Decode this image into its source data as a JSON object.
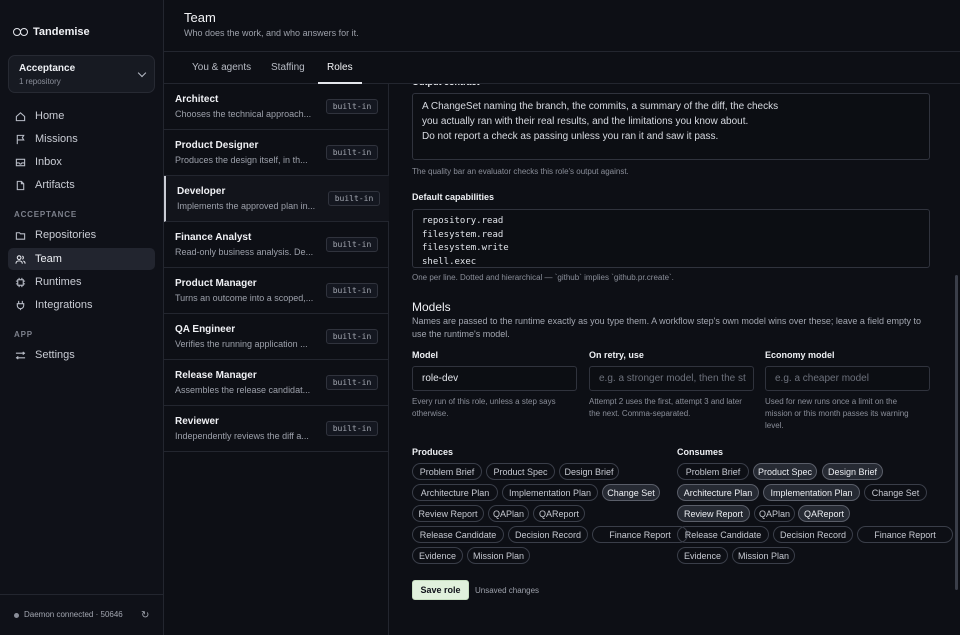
{
  "app": {
    "name": "Tandemise"
  },
  "workspace": {
    "name": "Acceptance",
    "sub": "1 repository"
  },
  "nav": {
    "main": [
      {
        "label": "Home",
        "icon": "home-icon"
      },
      {
        "label": "Missions",
        "icon": "flag-icon"
      },
      {
        "label": "Inbox",
        "icon": "inbox-icon"
      },
      {
        "label": "Artifacts",
        "icon": "file-icon"
      }
    ],
    "acceptance_label": "ACCEPTANCE",
    "acceptance": [
      {
        "label": "Repositories",
        "icon": "folder-icon"
      },
      {
        "label": "Team",
        "icon": "users-icon"
      },
      {
        "label": "Runtimes",
        "icon": "cpu-icon"
      },
      {
        "label": "Integrations",
        "icon": "plug-icon"
      }
    ],
    "app_label": "APP",
    "app": [
      {
        "label": "Settings",
        "icon": "sliders-icon"
      }
    ]
  },
  "daemon": {
    "status": "Daemon connected · 50646",
    "refresh_icon": "refresh-icon"
  },
  "header": {
    "title": "Team",
    "subtitle": "Who does the work, and who answers for it."
  },
  "tabs": [
    {
      "label": "You & agents"
    },
    {
      "label": "Staffing"
    },
    {
      "label": "Roles",
      "active": true
    }
  ],
  "roles": [
    {
      "name": "Architect",
      "desc": "Chooses the technical approach...",
      "badge": "built-in"
    },
    {
      "name": "Product Designer",
      "desc": "Produces the design itself, in th...",
      "badge": "built-in"
    },
    {
      "name": "Developer",
      "desc": "Implements the approved plan in...",
      "badge": "built-in",
      "selected": true
    },
    {
      "name": "Finance Analyst",
      "desc": "Read-only business analysis. De...",
      "badge": "built-in"
    },
    {
      "name": "Product Manager",
      "desc": "Turns an outcome into a scoped,...",
      "badge": "built-in"
    },
    {
      "name": "QA Engineer",
      "desc": "Verifies the running application ...",
      "badge": "built-in"
    },
    {
      "name": "Release Manager",
      "desc": "Assembles the release candidat...",
      "badge": "built-in"
    },
    {
      "name": "Reviewer",
      "desc": "Independently reviews the diff a...",
      "badge": "built-in"
    }
  ],
  "editor": {
    "output_contract": {
      "lines": [
        "A ChangeSet naming the branch, the commits, a summary of the diff, the checks",
        "you actually ran with their real results, and the limitations you know about.",
        "Do not report a check as passing unless you ran it and saw it pass."
      ],
      "hint": "The quality bar an evaluator checks this role's output against."
    },
    "capabilities": {
      "label": "Default capabilities",
      "lines": [
        "repository.read",
        "filesystem.read",
        "filesystem.write",
        "shell.exec"
      ],
      "hint": "One per line. Dotted and hierarchical — `github` implies `github.pr.create`."
    },
    "models": {
      "title": "Models",
      "desc": "Names are passed to the runtime exactly as you type them. A workflow step's own model wins over these; leave a field empty to use the runtime's model.",
      "model": {
        "label": "Model",
        "value": "role-dev",
        "hint": "Every run of this role, unless a step says otherwise."
      },
      "retry": {
        "label": "On retry, use",
        "placeholder": "e.g. a stronger model, then the st",
        "hint": "Attempt 2 uses the first, attempt 3 and later the next. Comma-separated."
      },
      "economy": {
        "label": "Economy model",
        "placeholder": "e.g. a cheaper model",
        "hint": "Used for new runs once a limit on the mission or this month passes its warning level."
      }
    },
    "produces": {
      "label": "Produces",
      "chips": [
        {
          "label": "Problem Brief",
          "on": false
        },
        {
          "label": "Product Spec",
          "on": false
        },
        {
          "label": "Design Brief",
          "on": false
        },
        {
          "label": "Architecture Plan",
          "on": false
        },
        {
          "label": "Implementation Plan",
          "on": false
        },
        {
          "label": "Change Set",
          "on": true
        },
        {
          "label": "Review Report",
          "on": false
        },
        {
          "label": "QAPlan",
          "on": false
        },
        {
          "label": "QAReport",
          "on": false
        },
        {
          "label": "Release Candidate",
          "on": false
        },
        {
          "label": "Decision Record",
          "on": false
        },
        {
          "label": "Finance Report",
          "on": false
        },
        {
          "label": "Evidence",
          "on": false
        },
        {
          "label": "Mission Plan",
          "on": false
        }
      ]
    },
    "consumes": {
      "label": "Consumes",
      "chips": [
        {
          "label": "Problem Brief",
          "on": false
        },
        {
          "label": "Product Spec",
          "on": true
        },
        {
          "label": "Design Brief",
          "on": true
        },
        {
          "label": "Architecture Plan",
          "on": true
        },
        {
          "label": "Implementation Plan",
          "on": true
        },
        {
          "label": "Change Set",
          "on": false
        },
        {
          "label": "Review Report",
          "on": true
        },
        {
          "label": "QAPlan",
          "on": false
        },
        {
          "label": "QAReport",
          "on": true
        },
        {
          "label": "Release Candidate",
          "on": false
        },
        {
          "label": "Decision Record",
          "on": false
        },
        {
          "label": "Finance Report",
          "on": false
        },
        {
          "label": "Evidence",
          "on": false
        },
        {
          "label": "Mission Plan",
          "on": false
        }
      ]
    },
    "save_label": "Save role",
    "unsaved": "Unsaved changes"
  }
}
